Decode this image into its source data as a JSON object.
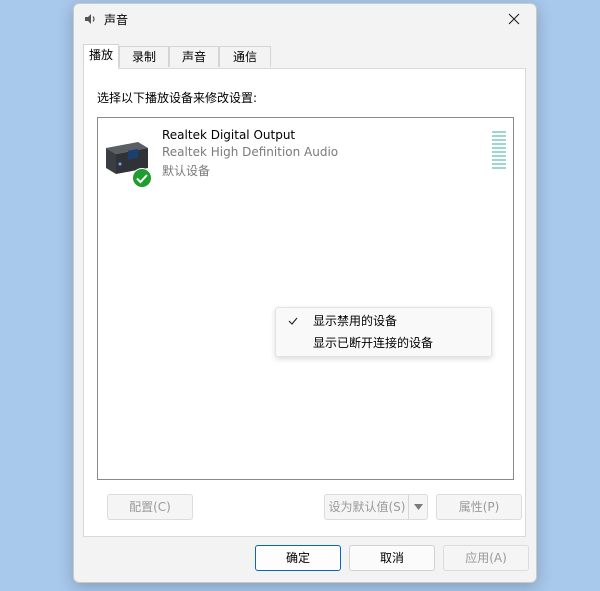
{
  "window": {
    "title": "声音",
    "close_label": "×"
  },
  "tabs": [
    {
      "label": "播放",
      "active": true
    },
    {
      "label": "录制",
      "active": false
    },
    {
      "label": "声音",
      "active": false
    },
    {
      "label": "通信",
      "active": false
    }
  ],
  "playback": {
    "instruction": "选择以下播放设备来修改设置:",
    "devices": [
      {
        "name": "Realtek Digital Output",
        "description": "Realtek High Definition Audio",
        "status": "默认设备",
        "icon": "speaker-icon",
        "default_badge": "green-check-icon"
      }
    ],
    "context_menu": [
      {
        "label": "显示禁用的设备",
        "checked": true
      },
      {
        "label": "显示已断开连接的设备",
        "checked": false
      }
    ],
    "buttons": {
      "configure": "配置(C)",
      "set_default": "设为默认值(S)",
      "properties": "属性(P)"
    }
  },
  "footer": {
    "ok": "确定",
    "cancel": "取消",
    "apply": "应用(A)"
  },
  "colors": {
    "accent": "#0a64c2",
    "check_green": "#1f9d2e",
    "meter": "#9ed6d0"
  }
}
